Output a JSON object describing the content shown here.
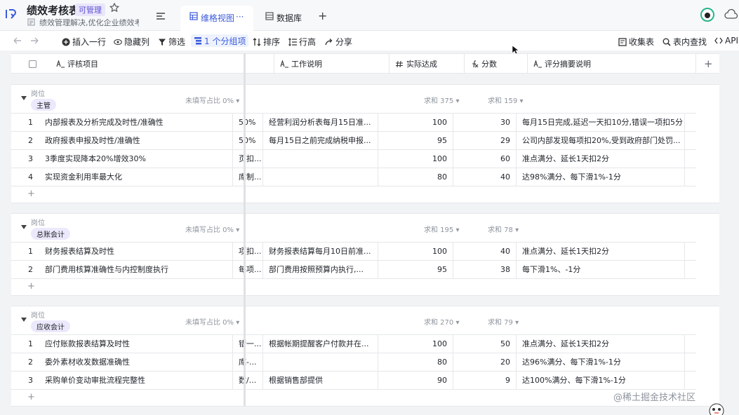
{
  "header": {
    "title": "绩效考核表",
    "badge": "可管理",
    "description": "绩效管理解决,优化企业绩效考...",
    "tabs": [
      {
        "label": "维格视图",
        "more": "···"
      },
      {
        "label": "数据库"
      }
    ],
    "add_tab": "+"
  },
  "toolbar": {
    "insert_row": "插入一行",
    "hide_cols": "隐藏列",
    "filter": "筛选",
    "group": "1 个分组项",
    "sort": "排序",
    "row_height": "行高",
    "share": "分享",
    "form": "收集表",
    "find": "表内查找",
    "api": "API"
  },
  "columns": [
    {
      "name": "评核项目",
      "icon": "text-icon"
    },
    {
      "name": "工作说明",
      "icon": "text-icon"
    },
    {
      "name": "实际达成",
      "icon": "number-icon"
    },
    {
      "name": "分数",
      "icon": "formula-icon"
    },
    {
      "name": "评分摘要说明",
      "icon": "text-icon"
    }
  ],
  "add_column": "+",
  "groups": [
    {
      "field_label": "岗位",
      "value": "主管",
      "fill_ratio": "未填写占比 0%",
      "sum_actual": "求和 375",
      "sum_score": "求和 159",
      "rows": [
        {
          "no": "1",
          "item": "内部报表及分析完成及时性/准确性",
          "hidden": "50%",
          "work": "经营利润分析表每月15日准...",
          "actual": "100",
          "score": "30",
          "summary": "每月15日完成,延迟一天扣10分,错误一项扣5分"
        },
        {
          "no": "2",
          "item": "政府报表申报及时性/准确性",
          "hidden": "50%",
          "work": "每月15日之前完成纳税申报...",
          "actual": "95",
          "score": "29",
          "summary": "公司内部发现每项扣20%,受到政府部门处罚..."
        },
        {
          "no": "3",
          "item": "3季度实现降本20%增效30%",
          "hidden": "页扣...",
          "work": "",
          "actual": "100",
          "score": "60",
          "summary": "准点满分、延长1天扣2分"
        },
        {
          "no": "4",
          "item": "实现资金利用率最大化",
          "hidden": "库制...",
          "work": "",
          "actual": "80",
          "score": "40",
          "summary": "达98%满分、每下滑1%-1分"
        }
      ]
    },
    {
      "field_label": "岗位",
      "value": "总账会计",
      "fill_ratio": "未填写占比 0%",
      "sum_actual": "求和 195",
      "sum_score": "求和 78",
      "rows": [
        {
          "no": "1",
          "item": "财务报表结算及时性",
          "hidden": "项扣...",
          "work": "财务报表结算每月10日前准...",
          "actual": "100",
          "score": "40",
          "summary": "准点满分、延长1天扣2分"
        },
        {
          "no": "2",
          "item": "部门费用核算准确性与内控制度执行",
          "hidden": "每项...",
          "work": "部门费用按照预算内执行,...",
          "actual": "95",
          "score": "38",
          "summary": "每下滑1%、-1分"
        }
      ]
    },
    {
      "field_label": "岗位",
      "value": "应收会计",
      "fill_ratio": "未填写占比 0%",
      "sum_actual": "求和 270",
      "sum_score": "求和 79",
      "rows": [
        {
          "no": "1",
          "item": "应付账款报表结算及时性",
          "hidden": "错一...",
          "work": "根据帐期提醒客户付款并在...",
          "actual": "100",
          "score": "50",
          "summary": "准点满分、延长1天扣2分"
        },
        {
          "no": "2",
          "item": "委外素材收发数据准确性",
          "hidden": "库-...",
          "work": "",
          "actual": "80",
          "score": "20",
          "summary": "达96%满分、每下滑1%-1分"
        },
        {
          "no": "3",
          "item": "采购单价变动审批流程完整性",
          "hidden": "数/...",
          "work": "根据销售部提供",
          "actual": "90",
          "score": "9",
          "summary": "达100%满分、每下滑1%-1分"
        }
      ]
    }
  ],
  "add_row": "+",
  "watermark": "@稀土掘金技术社区"
}
